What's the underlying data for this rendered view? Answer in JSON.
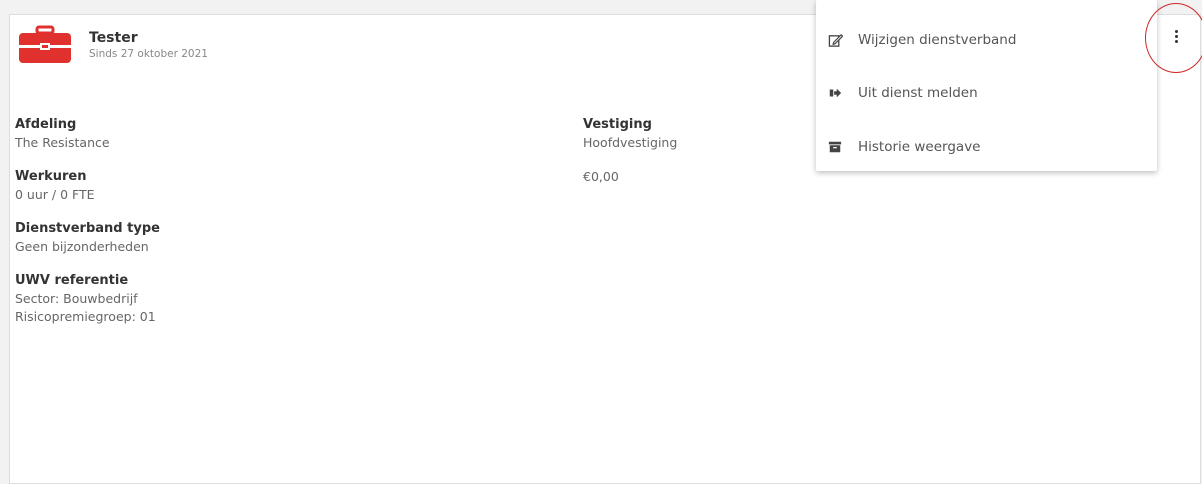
{
  "employee": {
    "name": "Tester",
    "since": "Sinds 27 oktober 2021",
    "icon": "toolbox-icon",
    "icon_color": "#e0312f"
  },
  "left_fields": [
    {
      "label": "Afdeling",
      "value": "The Resistance"
    },
    {
      "label": "Werkuren",
      "value": "0 uur / 0 FTE"
    },
    {
      "label": "Dienstverband type",
      "value": "Geen bijzonderheden"
    },
    {
      "label": "UWV referentie",
      "value": "Sector: Bouwbedrijf",
      "value2": "Risicopremiegroep: 01"
    }
  ],
  "right_fields": [
    {
      "label": "Vestiging",
      "value": "Hoofdvestiging"
    },
    {
      "value": "€0,00"
    }
  ],
  "menu": {
    "items": [
      {
        "label": "Wijzigen dienstverband",
        "icon": "edit-icon"
      },
      {
        "label": "Uit dienst melden",
        "icon": "sign-out-icon"
      },
      {
        "label": "Historie weergave",
        "icon": "archive-icon"
      }
    ]
  },
  "colors": {
    "accent": "#e0312f",
    "highlight": "#cc2a2a"
  }
}
